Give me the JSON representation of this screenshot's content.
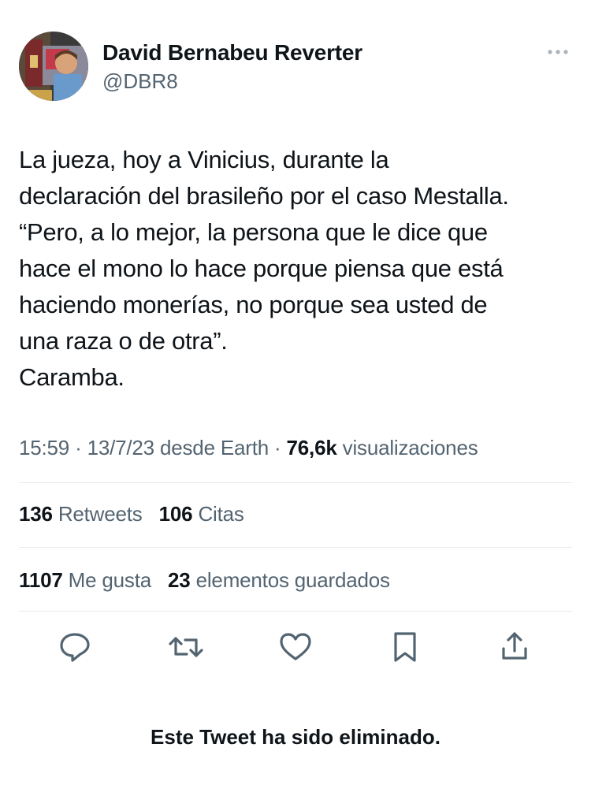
{
  "author": {
    "name": "David Bernabeu Reverter",
    "handle": "@DBR8",
    "avatar": "profile-photo"
  },
  "more_icon": "more-dots-icon",
  "tweet": {
    "text": "La jueza, hoy a Vinicius, durante la\ndeclaración del brasileño por el caso Mestalla.\n“Pero, a lo mejor, la persona que le dice que\nhace el mono lo hace porque piensa que está\nhaciendo monerías, no porque sea usted de\nuna raza o de otra”.\nCaramba."
  },
  "meta": {
    "time": "15:59",
    "date": "13/7/23",
    "source_prefix": "desde",
    "source": "Earth",
    "views_count": "76,6k",
    "views_label": "visualizaciones"
  },
  "stats": {
    "retweets_count": "136",
    "retweets_label": "Retweets",
    "quotes_count": "106",
    "quotes_label": "Citas",
    "likes_count": "1107",
    "likes_label": "Me gusta",
    "bookmarks_count": "23",
    "bookmarks_label": "elementos guardados"
  },
  "actions": [
    {
      "name": "reply",
      "icon": "reply-icon"
    },
    {
      "name": "retweet",
      "icon": "retweet-icon"
    },
    {
      "name": "like",
      "icon": "heart-icon"
    },
    {
      "name": "bookmark",
      "icon": "bookmark-icon"
    },
    {
      "name": "share",
      "icon": "share-icon"
    }
  ],
  "colors": {
    "text_primary": "#0f1419",
    "text_secondary": "#536471",
    "divider": "#e6e9ec",
    "icon": "#536471"
  },
  "notice": "Este Tweet ha sido eliminado."
}
